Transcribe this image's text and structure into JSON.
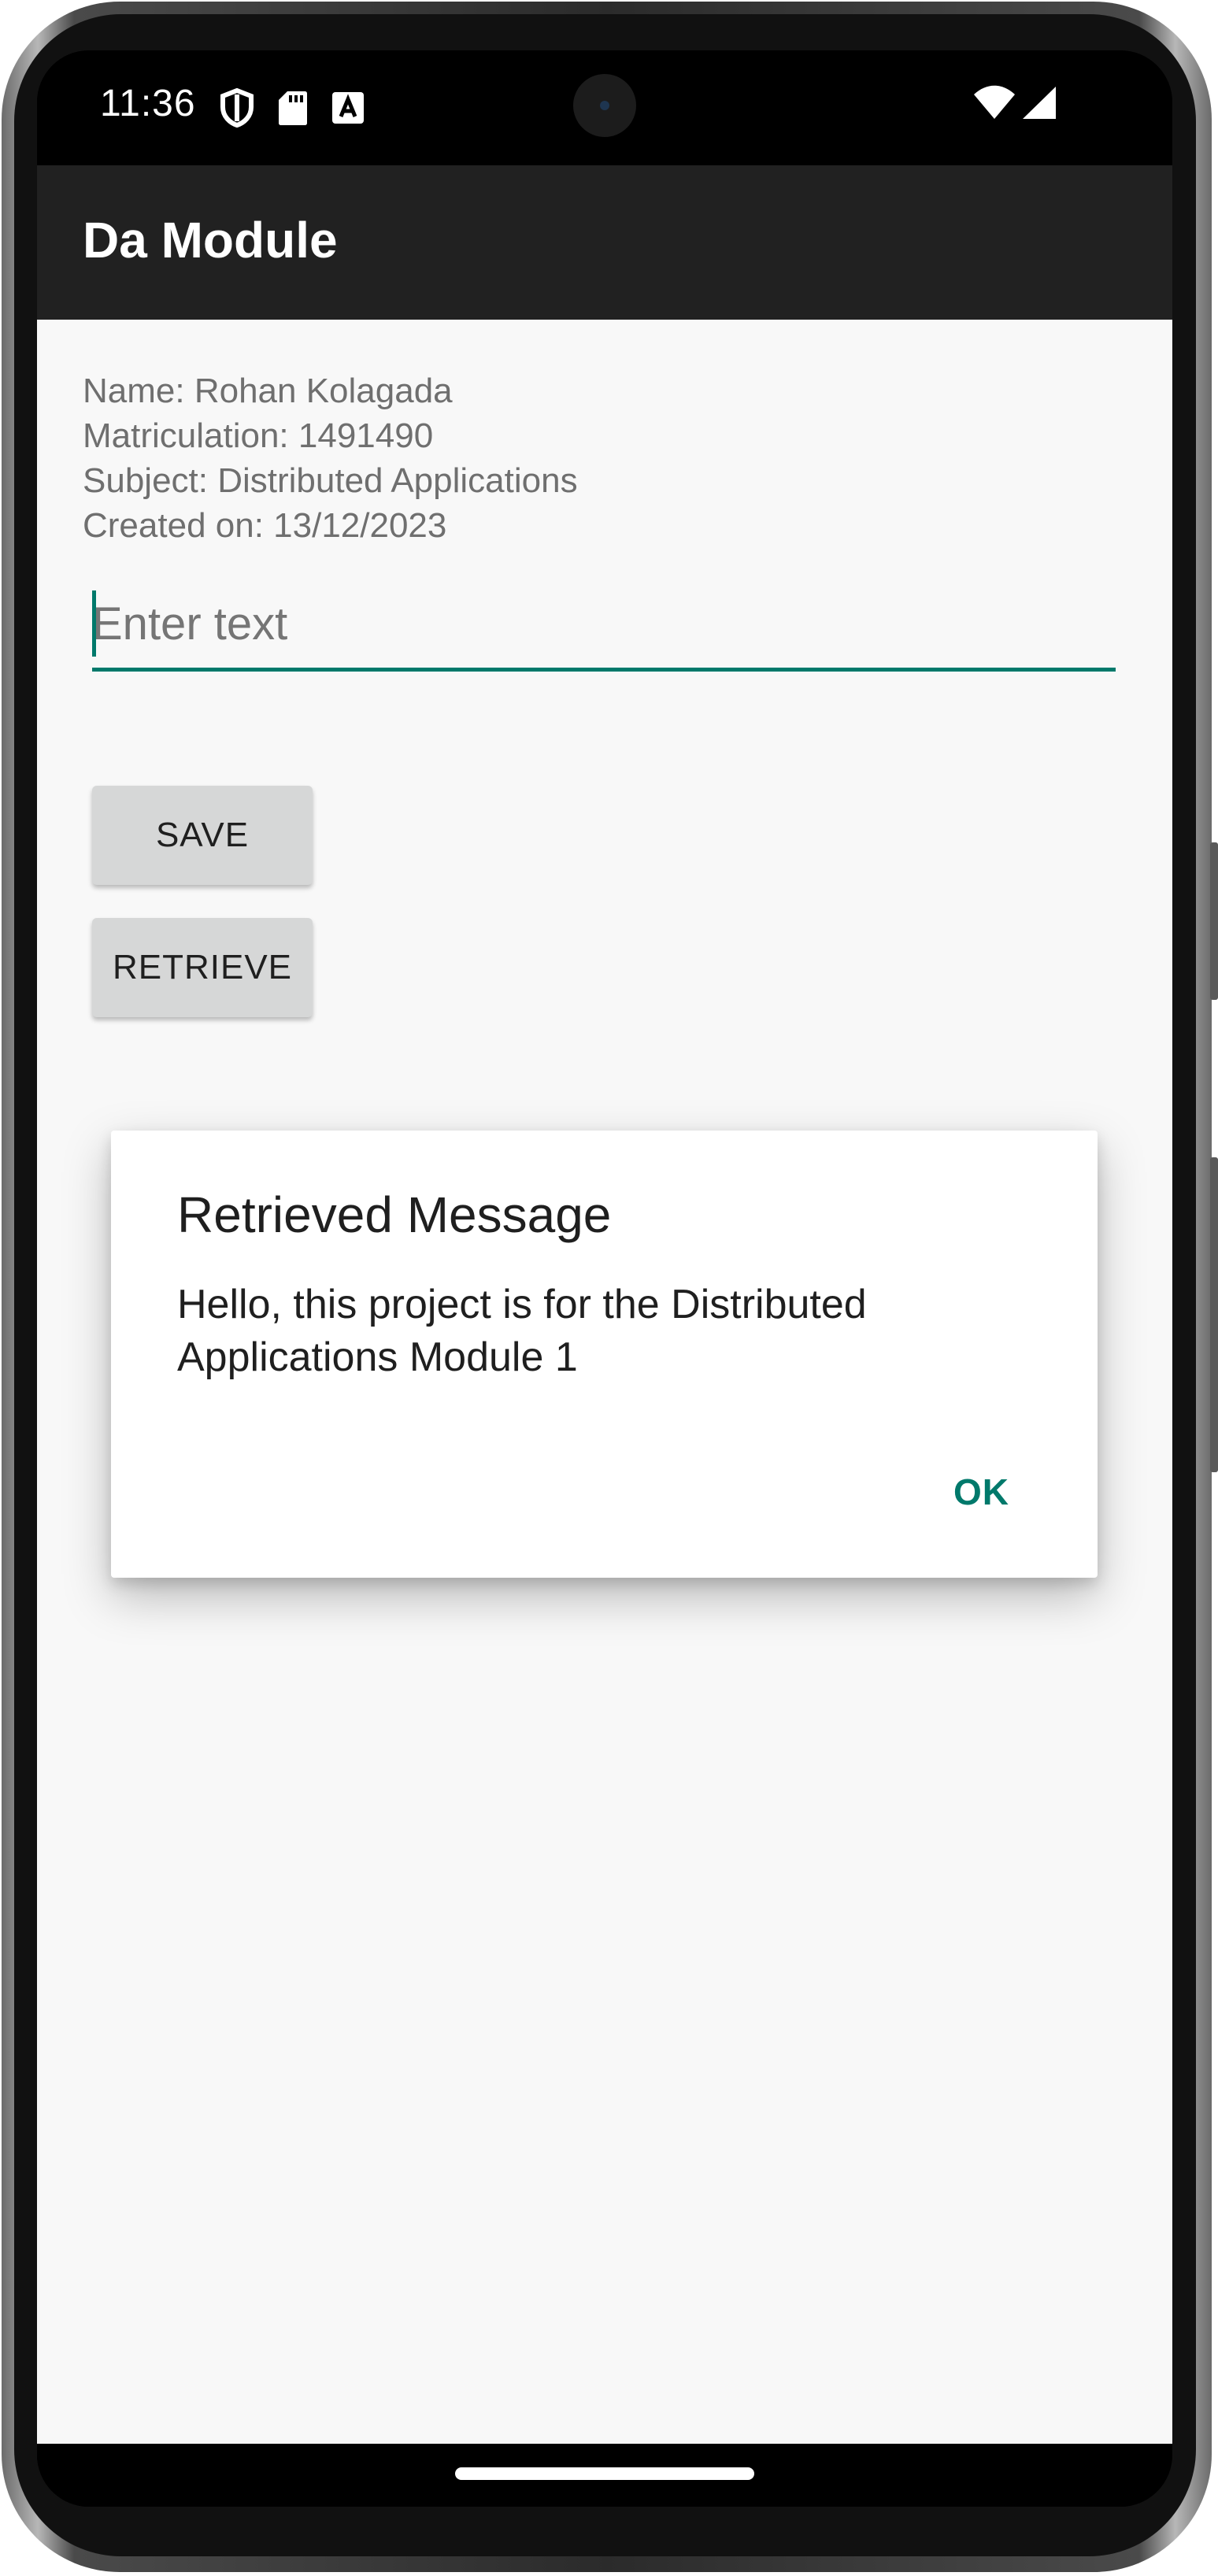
{
  "status_bar": {
    "time": "11:36"
  },
  "app_bar": {
    "title": "Da Module"
  },
  "info": {
    "name": "Name: Rohan Kolagada",
    "matriculation": "Matriculation: 1491490",
    "subject": "Subject: Distributed Applications",
    "created": "Created on: 13/12/2023"
  },
  "input": {
    "value": "",
    "placeholder": "Enter text"
  },
  "buttons": {
    "save": "SAVE",
    "retrieve": "RETRIEVE"
  },
  "dialog": {
    "title": "Retrieved Message",
    "message": "Hello, this project is for the Distributed Applications Module 1",
    "ok": "OK"
  },
  "colors": {
    "accent": "#00796b",
    "app_bar": "#212121",
    "background": "#f8f8f8",
    "button": "#d6d7d7"
  }
}
